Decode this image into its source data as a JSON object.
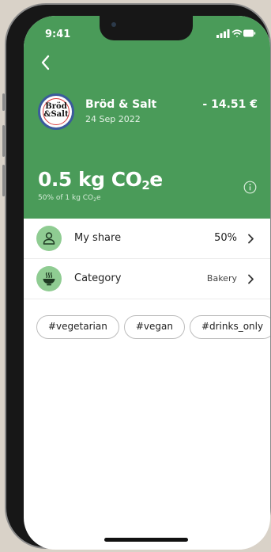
{
  "status_bar": {
    "time": "9:41",
    "icons": [
      "signal-icon",
      "wifi-icon",
      "battery-icon"
    ]
  },
  "header": {
    "back_icon": "chevron-left-icon",
    "merchant": {
      "logo_text_line1": "Bröd",
      "logo_text_line2": "&Salt",
      "name": "Bröd & Salt",
      "date": "24 Sep 2022"
    },
    "amount": "- 14.51 €",
    "emission": {
      "value": "0.5 kg CO",
      "value_subscript": "2",
      "value_suffix": "e",
      "subtitle": "50% of 1 kg CO",
      "subtitle_subscript": "2",
      "subtitle_suffix": "e"
    },
    "info_icon": "info-icon"
  },
  "rows": [
    {
      "icon": "person-icon",
      "label": "My share",
      "value": "50%"
    },
    {
      "icon": "bowl-icon",
      "label": "Category",
      "value": "Bakery"
    }
  ],
  "tags": [
    "#vegetarian",
    "#vegan",
    "#drinks_only"
  ],
  "colors": {
    "header_green": "#4a9b59",
    "icon_circle": "#8fcc92",
    "background": "#d9d2c8"
  }
}
